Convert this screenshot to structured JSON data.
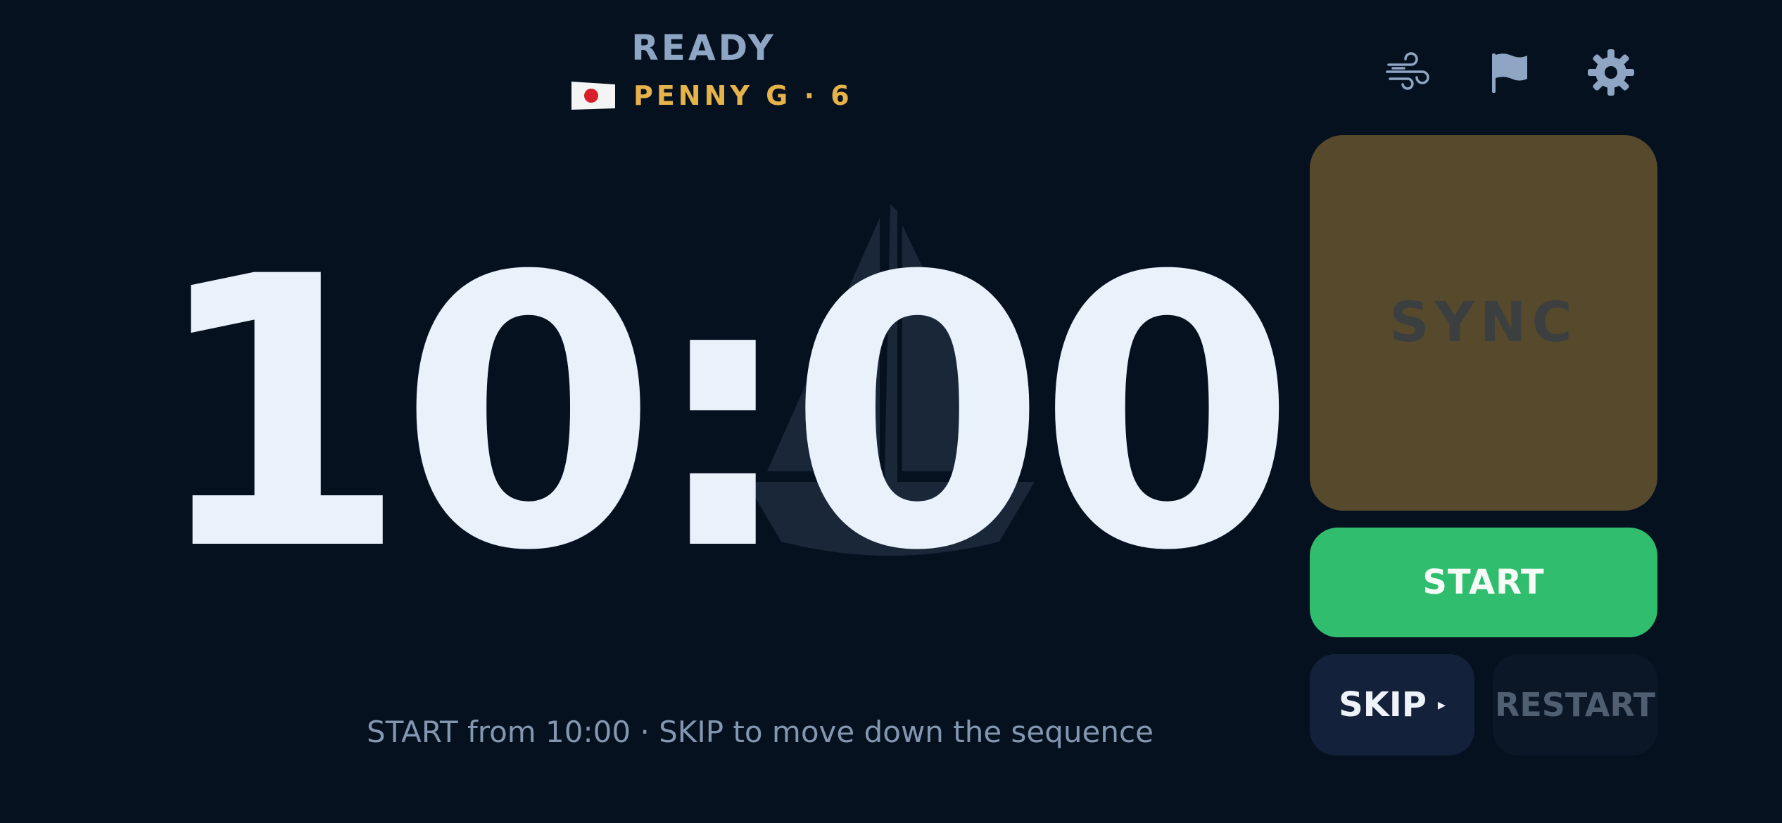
{
  "header": {
    "status": "READY",
    "class_name": "PENNY G · 6",
    "flag_icon": "japan-flag-icon"
  },
  "toolbar": {
    "wind_icon": "wind-icon",
    "flag_icon": "flag-icon",
    "settings_icon": "gear-icon"
  },
  "timer": {
    "display": "10:00"
  },
  "buttons": {
    "sync_label": "SYNC",
    "start_label": "START",
    "skip_label": "SKIP",
    "skip_arrow": "▸",
    "restart_label": "RESTART"
  },
  "hint": {
    "text": "START from 10:00 · SKIP to move down the sequence"
  },
  "colors": {
    "background": "#061120",
    "status": "#8ea6c3",
    "class_accent": "#e6b24a",
    "sync": "#574a2c",
    "start": "#30be6e",
    "skip": "#14213a",
    "restart": "#0b1627",
    "timer_text": "#e9f2fb"
  }
}
